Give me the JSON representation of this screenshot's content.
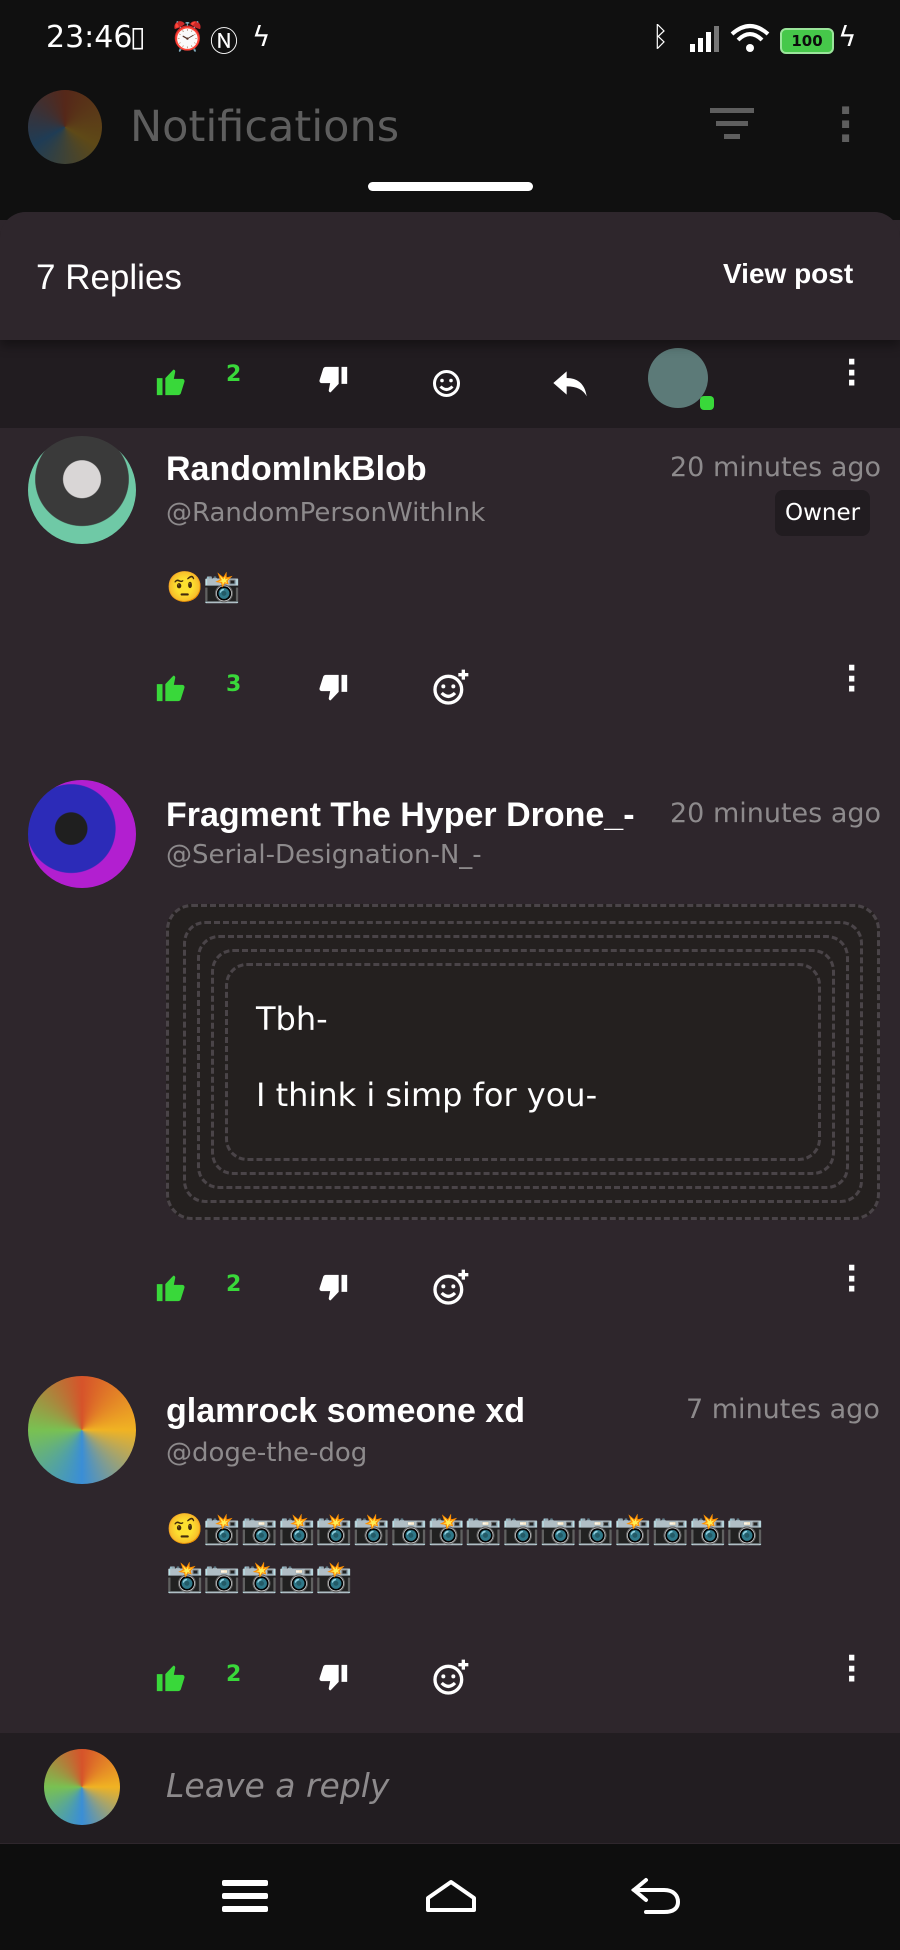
{
  "status_bar": {
    "time": "23:46",
    "battery": "100"
  },
  "background_header": {
    "title": "Notifications"
  },
  "sheet": {
    "replies_label": "7 Replies",
    "view_post_label": "View post"
  },
  "parent_post": {
    "like_count": "2"
  },
  "comments": [
    {
      "name": "RandomInkBlob",
      "handle": "@RandomPersonWithInk",
      "time": "20 minutes ago",
      "badge": "Owner",
      "text_emoji": "🤨📸",
      "like_count": "3"
    },
    {
      "name": "Fragment The Hyper Drone_-",
      "handle": "@Serial-Designation-N_-",
      "time": "20 minutes ago",
      "quote_lines": [
        "Tbh-",
        "I think i simp for you-"
      ],
      "like_count": "2"
    },
    {
      "name": "glamrock someone xd",
      "handle": "@doge-the-dog",
      "time": "7 minutes ago",
      "text_emoji_line1": "🤨📸📷📸📸📸📷📸📷📷📷📷📸📷📸📷",
      "text_emoji_line2": "📸📷📸📷📸",
      "like_count": "2"
    }
  ],
  "reply_input": {
    "placeholder": "Leave a reply"
  },
  "icons": [
    "thumbs-up-icon",
    "thumbs-down-icon",
    "add-reaction-icon",
    "reply-icon",
    "more-vertical-icon",
    "filter-icon",
    "menu-icon",
    "home-icon",
    "back-icon"
  ],
  "colors": {
    "accent_green": "#39d83a",
    "background": "#2e262c",
    "surface_dark": "#211c20"
  }
}
